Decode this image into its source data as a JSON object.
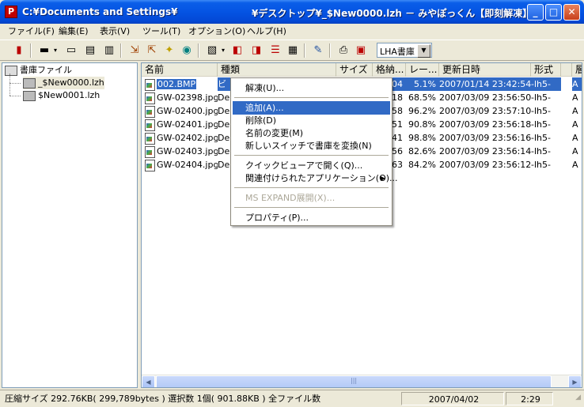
{
  "window": {
    "title_path": "C:¥Documents and Settings¥",
    "title_app": "¥デスクトップ¥_$New0000.lzh － みやぽっくん【即刻解凍】",
    "app_icon": "lzh-app-icon",
    "minimize": "_",
    "maximize": "□",
    "close": "✕"
  },
  "menu": [
    "ファイル(F)",
    "編集(E)",
    "表示(V)",
    "ツール(T)",
    "オプション(O)",
    "ヘルプ(H)"
  ],
  "toolbar": {
    "icons": [
      "exit-icon",
      "dropdown-icon",
      "open-icon",
      "new-icon",
      "save-icon",
      "extract-icon",
      "add-icon",
      "delete-icon",
      "view-icon",
      "list-icon",
      "up-icon",
      "search-icon",
      "info-icon",
      "tool-icon",
      "print-icon",
      "properties-icon"
    ],
    "archive_type": "LHA書庫"
  },
  "tree": {
    "root": "書庫ファイル",
    "items": [
      "_$New0000.lzh",
      "$New0001.lzh"
    ]
  },
  "list": {
    "columns": [
      "名前",
      "種類",
      "サイズ",
      "格納...",
      "レー...",
      "更新日時",
      "形式",
      "層"
    ],
    "rows": [
      {
        "name": "002.BMP",
        "type": "ビ",
        "size": "",
        "packed": "04",
        "ratio": "5.1%",
        "date": "2007/01/14 23:42:54",
        "format": "-lh5-",
        "extra": "A"
      },
      {
        "name": "GW-02398.jpg",
        "type": "De",
        "size": "",
        "packed": "18",
        "ratio": "68.5%",
        "date": "2007/03/09 23:56:50",
        "format": "-lh5-",
        "extra": "A"
      },
      {
        "name": "GW-02400.jpg",
        "type": "De",
        "size": "",
        "packed": "58",
        "ratio": "96.2%",
        "date": "2007/03/09 23:57:10",
        "format": "-lh5-",
        "extra": "A"
      },
      {
        "name": "GW-02401.jpg",
        "type": "De",
        "size": "",
        "packed": "51",
        "ratio": "90.8%",
        "date": "2007/03/09 23:56:18",
        "format": "-lh5-",
        "extra": "A"
      },
      {
        "name": "GW-02402.jpg",
        "type": "De",
        "size": "",
        "packed": "41",
        "ratio": "98.8%",
        "date": "2007/03/09 23:56:16",
        "format": "-lh5-",
        "extra": "A"
      },
      {
        "name": "GW-02403.jpg",
        "type": "De",
        "size": "",
        "packed": "56",
        "ratio": "82.6%",
        "date": "2007/03/09 23:56:14",
        "format": "-lh5-",
        "extra": "A"
      },
      {
        "name": "GW-02404.jpg",
        "type": "De",
        "size": "",
        "packed": "63",
        "ratio": "84.2%",
        "date": "2007/03/09 23:56:12",
        "format": "-lh5-",
        "extra": "A"
      }
    ]
  },
  "context_menu": {
    "items": [
      {
        "label": "解凍(U)...",
        "state": "normal"
      },
      {
        "label": "追加(A)...",
        "state": "highlighted"
      },
      {
        "label": "削除(D)",
        "state": "normal"
      },
      {
        "label": "名前の変更(M)",
        "state": "normal"
      },
      {
        "label": "新しいスイッチで書庫を変換(N)",
        "state": "normal"
      },
      {
        "label": "クイックビューアで開く(Q)...",
        "state": "normal"
      },
      {
        "label": "関連付けられたアプリケーション(O)...",
        "state": "submenu"
      },
      {
        "label": "MS EXPAND展開(X)...",
        "state": "disabled"
      },
      {
        "label": "プロパティ(P)...",
        "state": "normal"
      }
    ]
  },
  "status": {
    "summary": "圧縮サイズ 292.76KB( 299,789bytes )  選択数 1個( 901.88KB ) 全ファイル数",
    "date": "2007/04/02",
    "time": "2:29"
  }
}
